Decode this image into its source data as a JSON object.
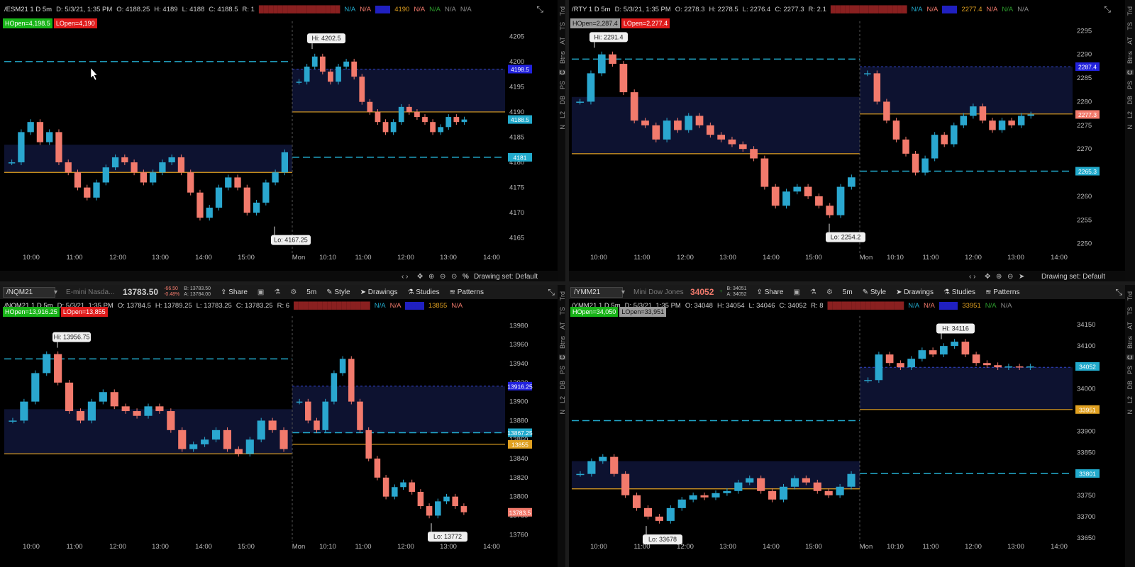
{
  "colors": {
    "up": "#2aa7cf",
    "down": "#f27a6c",
    "orange": "#e0a020",
    "teal": "#22aacc",
    "zone": "#0d1230"
  },
  "rail_tabs": [
    "Trd",
    "TS",
    "AT",
    "Btns",
    "C",
    "PS",
    "DB",
    "L2",
    "N"
  ],
  "footer": {
    "drawing_set": "Drawing set: Default",
    "percent": "%"
  },
  "panels": {
    "esm": {
      "title": "/ESM21 1 D 5m",
      "date": "D: 5/3/21, 1:35 PM",
      "open": "O: 4188.25",
      "high": "H: 4189",
      "low": "L: 4188",
      "close": "C: 4188.5",
      "extra": "R: 1",
      "na1": "N/A",
      "na2": "N/A",
      "price_tag": "4190",
      "na3": "N/A",
      "na4": "N/A",
      "na5": "N/A",
      "na6": "N/A",
      "hopen": "HOpen=4,198.5",
      "lopen": "LOpen=4,190",
      "hi_label": "Hi: 4202.5",
      "lo_label": "Lo: 4167.25",
      "price_labels": [
        "4198.5",
        "4188.5",
        "4181"
      ],
      "y_ticks": [
        "4205",
        "4200",
        "4195",
        "4190",
        "4185",
        "4180",
        "4175",
        "4170",
        "4165"
      ],
      "x_ticks": [
        "10:00",
        "11:00",
        "12:00",
        "13:00",
        "14:00",
        "15:00",
        "Mon",
        "10:10",
        "11:00",
        "12:00",
        "13:00",
        "14:00"
      ]
    },
    "rty": {
      "title": "/RTY 1 D 5m",
      "date": "D: 5/3/21, 1:35 PM",
      "open": "O: 2278.3",
      "high": "H: 2278.5",
      "low": "L: 2276.4",
      "close": "C: 2277.3",
      "extra": "R: 2.1",
      "na1": "N/A",
      "na2": "N/A",
      "price_tag": "2277.4",
      "na3": "N/A",
      "na4": "N/A",
      "na5": "N/A",
      "hopen": "HOpen=2,287.4",
      "lopen": "LOpen=2,277.4",
      "hi_label": "Hi: 2291.4",
      "lo_label": "Lo: 2254.2",
      "price_labels": [
        "2287.4",
        "2277.3",
        "2265.3"
      ],
      "y_ticks": [
        "2295",
        "2290",
        "2285",
        "2280",
        "2275",
        "2270",
        "2265",
        "2260",
        "2255",
        "2250"
      ],
      "x_ticks": [
        "10:00",
        "11:00",
        "12:00",
        "13:00",
        "14:00",
        "15:00",
        "Mon",
        "10:10",
        "11:00",
        "12:00",
        "13:00",
        "14:00"
      ]
    },
    "nq": {
      "symbol": "/NQM21",
      "description": "E-mini Nasda...",
      "last": "13783.50",
      "change": "-66.50",
      "change_pct": "-0.48%",
      "bid": "B: 13783.50",
      "ask": "A: 13784.00",
      "share": "Share",
      "interval": "5m",
      "style": "Style",
      "drawings": "Drawings",
      "studies": "Studies",
      "patterns": "Patterns",
      "title": "/NQM21 1 D 5m",
      "date": "D: 5/3/21, 1:35 PM",
      "open": "O: 13784.5",
      "high": "H: 13789.25",
      "low": "L: 13783.25",
      "close": "C: 13783.25",
      "extra": "R: 6",
      "na1": "N/A",
      "na2": "N/A",
      "price_tag": "13855",
      "na3": "N/A",
      "hopen": "HOpen=13,916.25",
      "lopen": "LOpen=13,855",
      "hi_label": "Hi: 13956.75",
      "lo_label": "Lo: 13772",
      "price_labels": [
        "13916.25",
        "13867.25",
        "13855",
        "13783.5"
      ],
      "y_ticks": [
        "13980",
        "13960",
        "13940",
        "13920",
        "13900",
        "13880",
        "13860",
        "13840",
        "13820",
        "13800",
        "13780",
        "13760"
      ],
      "x_ticks": [
        "10:00",
        "11:00",
        "12:00",
        "13:00",
        "14:00",
        "15:00",
        "Mon",
        "10:10",
        "11:00",
        "12:00",
        "13:00",
        "14:00"
      ]
    },
    "ym": {
      "symbol": "/YMM21",
      "description": "Mini Dow Jones In...",
      "last": "34052",
      "change": "+",
      "change_pct": "",
      "bid": "B: 34051",
      "ask": "A: 34052",
      "share": "Share",
      "interval": "5m",
      "style": "Style",
      "drawings": "Drawings",
      "studies": "Studies",
      "patterns": "Patterns",
      "title": "/YMM21 1 D 5m",
      "date": "D: 5/3/21, 1:35 PM",
      "open": "O: 34048",
      "high": "H: 34054",
      "low": "L: 34046",
      "close": "C: 34052",
      "extra": "R: 8",
      "na1": "N/A",
      "na2": "N/A",
      "price_tag": "33951",
      "na3": "N/A",
      "na4": "N/A",
      "hopen": "HOpen=34,050",
      "lopen": "LOpen=33,951",
      "hi_label": "Hi: 34116",
      "lo_label": "Lo: 33678",
      "price_labels": [
        "34052",
        "33951",
        "33801"
      ],
      "y_ticks": [
        "34150",
        "34100",
        "34050",
        "34000",
        "33950",
        "33900",
        "33850",
        "33800",
        "33750",
        "33700",
        "33650"
      ],
      "x_ticks": [
        "10:00",
        "11:00",
        "12:00",
        "13:00",
        "14:00",
        "15:00",
        "Mon",
        "10:10",
        "11:00",
        "12:00",
        "13:00",
        "14:00"
      ]
    }
  },
  "chart_data": [
    {
      "type": "candlestick",
      "symbol": "/ESM21",
      "timeframe": "1 D 5m",
      "ylim": [
        4162,
        4208
      ],
      "levels": {
        "hopen": 4198.5,
        "lopen": 4190,
        "prior_high": 4200,
        "prior_low": 4181,
        "zone_prev": [
          4178,
          4183.5
        ],
        "zone_today": [
          4190,
          4198.5
        ]
      },
      "series": [
        {
          "segment": "prior",
          "closes": [
            4180,
            4186,
            4188,
            4184,
            4186,
            4180,
            4178,
            4175,
            4173,
            4176,
            4179,
            4181,
            4180,
            4178,
            4176,
            4178,
            4180,
            4181,
            4178,
            4174,
            4169,
            4171,
            4175,
            4177,
            4175,
            4170,
            4172,
            4176,
            4178,
            4182
          ]
        },
        {
          "segment": "today",
          "closes": [
            4196,
            4199,
            4201,
            4198,
            4196,
            4199,
            4200,
            4197,
            4192,
            4190,
            4188,
            4186,
            4188,
            4191,
            4190,
            4189,
            4188,
            4186,
            4187,
            4189,
            4188,
            4188.5
          ]
        }
      ]
    },
    {
      "type": "candlestick",
      "symbol": "/RTY",
      "timeframe": "1 D 5m",
      "ylim": [
        2248,
        2297
      ],
      "levels": {
        "hopen": 2287.4,
        "lopen": 2277.4,
        "prior_high": 2289,
        "prior_low": 2265.3,
        "zone_prev": [
          2269,
          2281
        ],
        "zone_today": [
          2277.4,
          2287.4
        ]
      },
      "series": [
        {
          "segment": "prior",
          "closes": [
            2280,
            2286,
            2290,
            2288,
            2282,
            2276,
            2275,
            2272,
            2276,
            2274,
            2277,
            2275,
            2273,
            2272,
            2271,
            2270,
            2268,
            2262,
            2258,
            2261,
            2262,
            2260,
            2258,
            2256,
            2262,
            2264
          ]
        },
        {
          "segment": "today",
          "closes": [
            2286,
            2280,
            2276,
            2272,
            2269,
            2265,
            2268,
            2273,
            2271,
            2275,
            2277,
            2279,
            2276,
            2274,
            2276,
            2275,
            2277,
            2277.3
          ]
        }
      ]
    },
    {
      "type": "candlestick",
      "symbol": "/NQM21",
      "timeframe": "1 D 5m",
      "ylim": [
        13752,
        13990
      ],
      "levels": {
        "hopen": 13916.25,
        "lopen": 13855,
        "prior_high": 13945,
        "prior_low": 13867.25,
        "zone_prev": [
          13845,
          13892
        ],
        "zone_today": [
          13867,
          13916
        ]
      },
      "series": [
        {
          "segment": "prior",
          "closes": [
            13880,
            13900,
            13930,
            13950,
            13920,
            13890,
            13880,
            13900,
            13910,
            13895,
            13890,
            13885,
            13895,
            13890,
            13870,
            13850,
            13855,
            13860,
            13870,
            13850,
            13845,
            13860,
            13880,
            13870,
            13850
          ]
        },
        {
          "segment": "today",
          "closes": [
            13900,
            13880,
            13870,
            13900,
            13930,
            13945,
            13900,
            13870,
            13840,
            13820,
            13800,
            13810,
            13815,
            13805,
            13790,
            13780,
            13795,
            13800,
            13790,
            13783.5
          ]
        }
      ]
    },
    {
      "type": "candlestick",
      "symbol": "/YMM21",
      "timeframe": "1 D 5m",
      "ylim": [
        33640,
        34170
      ],
      "levels": {
        "hopen": 34050,
        "lopen": 33951,
        "prior_high": 33925,
        "prior_low": 33801,
        "zone_prev": [
          33765,
          33830
        ],
        "zone_today": [
          33951,
          34050
        ]
      },
      "series": [
        {
          "segment": "prior",
          "closes": [
            33800,
            33830,
            33840,
            33800,
            33750,
            33720,
            33700,
            33690,
            33720,
            33740,
            33750,
            33745,
            33755,
            33760,
            33780,
            33790,
            33760,
            33740,
            33770,
            33790,
            33780,
            33760,
            33750,
            33770,
            33800
          ]
        },
        {
          "segment": "today",
          "closes": [
            34020,
            34080,
            34060,
            34050,
            34070,
            34090,
            34080,
            34100,
            34110,
            34080,
            34060,
            34055,
            34050,
            34052,
            34050,
            34052
          ]
        }
      ]
    }
  ]
}
